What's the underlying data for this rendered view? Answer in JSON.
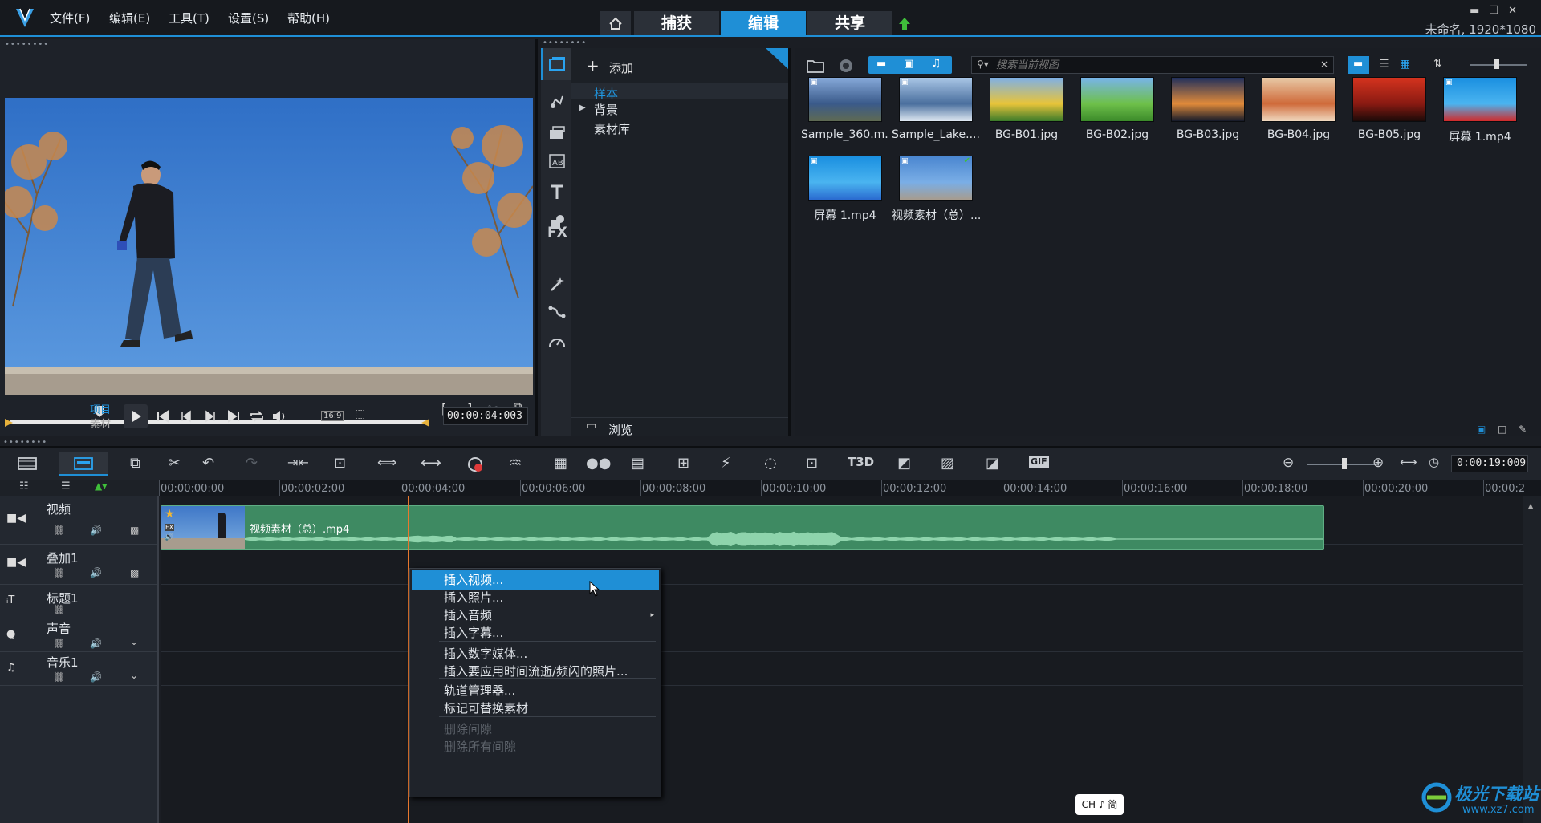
{
  "menu": [
    "文件(F)",
    "编辑(E)",
    "工具(T)",
    "设置(S)",
    "帮助(H)"
  ],
  "nav_tabs": {
    "capture": "捕获",
    "edit": "编辑",
    "share": "共享"
  },
  "window": {
    "project_info": "未命名, 1920*1080"
  },
  "preview": {
    "mode_project": "项目",
    "mode_clip": "素材",
    "aspect": "16:9",
    "timecode": "00:00:04:003"
  },
  "library": {
    "add_label": "添加",
    "tree": [
      "样本",
      "背景",
      "素材库"
    ],
    "browse_label": "浏览",
    "search_placeholder": "搜索当前视图",
    "items": [
      {
        "name": "Sample_360.m...",
        "type": "video"
      },
      {
        "name": "Sample_Lake....",
        "type": "video"
      },
      {
        "name": "BG-B01.jpg",
        "type": "image"
      },
      {
        "name": "BG-B02.jpg",
        "type": "image"
      },
      {
        "name": "BG-B03.jpg",
        "type": "image"
      },
      {
        "name": "BG-B04.jpg",
        "type": "image"
      },
      {
        "name": "BG-B05.jpg",
        "type": "image"
      },
      {
        "name": "屏幕 1.mp4",
        "type": "video"
      },
      {
        "name": "屏幕 1.mp4",
        "type": "video"
      },
      {
        "name": "视频素材（总）....",
        "type": "video"
      }
    ]
  },
  "categories": [
    "media-icon",
    "instant-project-icon",
    "transition-icon",
    "title-icon",
    "text-icon",
    "graphics-icon",
    "fx-icon",
    "filter-icon",
    "path-icon",
    "speed-icon"
  ],
  "category_labels": {
    "fx": "FX"
  },
  "timeline": {
    "duration": "0:00:19:009",
    "ruler_ticks": [
      "00:00:00:00",
      "00:00:02:00",
      "00:00:04:00",
      "00:00:06:00",
      "00:00:08:00",
      "00:00:10:00",
      "00:00:12:00",
      "00:00:14:00",
      "00:00:16:00",
      "00:00:18:00",
      "00:00:20:00",
      "00:00:2"
    ],
    "tracks": [
      "视频",
      "叠加1",
      "标题1",
      "声音",
      "音乐1"
    ],
    "clip_name": "视频素材（总）.mp4",
    "clip_fx": "FX"
  },
  "context_menu": [
    {
      "label": "插入视频...",
      "state": "highlighted"
    },
    {
      "label": "插入照片...",
      "state": "normal"
    },
    {
      "label": "插入音频",
      "state": "normal",
      "submenu": true
    },
    {
      "label": "插入字幕...",
      "state": "normal"
    },
    {
      "label": "插入数字媒体...",
      "state": "normal"
    },
    {
      "label": "插入要应用时间流逝/频闪的照片...",
      "state": "normal"
    },
    {
      "label": "轨道管理器...",
      "state": "normal"
    },
    {
      "label": "标记可替换素材",
      "state": "normal"
    },
    {
      "label": "删除间隙",
      "state": "disabled"
    },
    {
      "label": "删除所有间隙",
      "state": "disabled"
    }
  ],
  "ime": {
    "label": "CH ♪ 简"
  },
  "watermark": {
    "text": "极光下载站",
    "url": "www.xz7.com"
  },
  "colors": {
    "accent": "#1f8fd6",
    "clip_green": "#3e8a62",
    "playhead": "#e8782e"
  }
}
